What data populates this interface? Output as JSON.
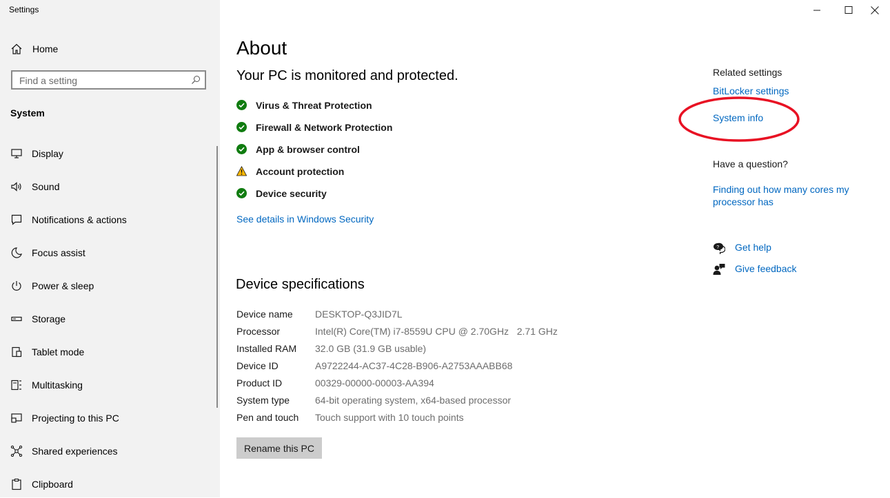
{
  "app": {
    "title": "Settings"
  },
  "sidebar": {
    "home_label": "Home",
    "search_placeholder": "Find a setting",
    "section": "System",
    "items": [
      {
        "label": "Display",
        "icon": "display-icon"
      },
      {
        "label": "Sound",
        "icon": "sound-icon"
      },
      {
        "label": "Notifications & actions",
        "icon": "notifications-icon"
      },
      {
        "label": "Focus assist",
        "icon": "moon-icon"
      },
      {
        "label": "Power & sleep",
        "icon": "power-icon"
      },
      {
        "label": "Storage",
        "icon": "storage-icon"
      },
      {
        "label": "Tablet mode",
        "icon": "tablet-icon"
      },
      {
        "label": "Multitasking",
        "icon": "multitasking-icon"
      },
      {
        "label": "Projecting to this PC",
        "icon": "projecting-icon"
      },
      {
        "label": "Shared experiences",
        "icon": "shared-icon"
      },
      {
        "label": "Clipboard",
        "icon": "clipboard-icon"
      }
    ]
  },
  "main": {
    "title": "About",
    "protection_heading": "Your PC is monitored and protected.",
    "status": [
      {
        "label": "Virus & Threat Protection",
        "state": "ok"
      },
      {
        "label": "Firewall & Network Protection",
        "state": "ok"
      },
      {
        "label": "App & browser control",
        "state": "ok"
      },
      {
        "label": "Account protection",
        "state": "warning"
      },
      {
        "label": "Device security",
        "state": "ok"
      }
    ],
    "security_link": "See details in Windows Security",
    "specs_heading": "Device specifications",
    "specs": [
      {
        "key": "Device name",
        "value": "DESKTOP-Q3JID7L"
      },
      {
        "key": "Processor",
        "value": "Intel(R) Core(TM) i7-8559U CPU @ 2.70GHz   2.71 GHz"
      },
      {
        "key": "Installed RAM",
        "value": "32.0 GB (31.9 GB usable)"
      },
      {
        "key": "Device ID",
        "value": "A9722244-AC37-4C28-B906-A2753AAABB68"
      },
      {
        "key": "Product ID",
        "value": "00329-00000-00003-AA394"
      },
      {
        "key": "System type",
        "value": "64-bit operating system, x64-based processor"
      },
      {
        "key": "Pen and touch",
        "value": "Touch support with 10 touch points"
      }
    ],
    "rename_button": "Rename this PC"
  },
  "related": {
    "heading": "Related settings",
    "links": [
      "BitLocker settings",
      "System info"
    ],
    "question_heading": "Have a question?",
    "question_link": "Finding out how many cores my processor has",
    "help": [
      {
        "label": "Get help",
        "icon": "get-help-icon"
      },
      {
        "label": "Give feedback",
        "icon": "feedback-icon"
      }
    ]
  },
  "colors": {
    "link": "#0067c0",
    "ok": "#107c10",
    "warning": "#ffb900",
    "highlight": "#e81123",
    "sidebar_bg": "#f2f2f2",
    "button_bg": "#cccccc"
  }
}
